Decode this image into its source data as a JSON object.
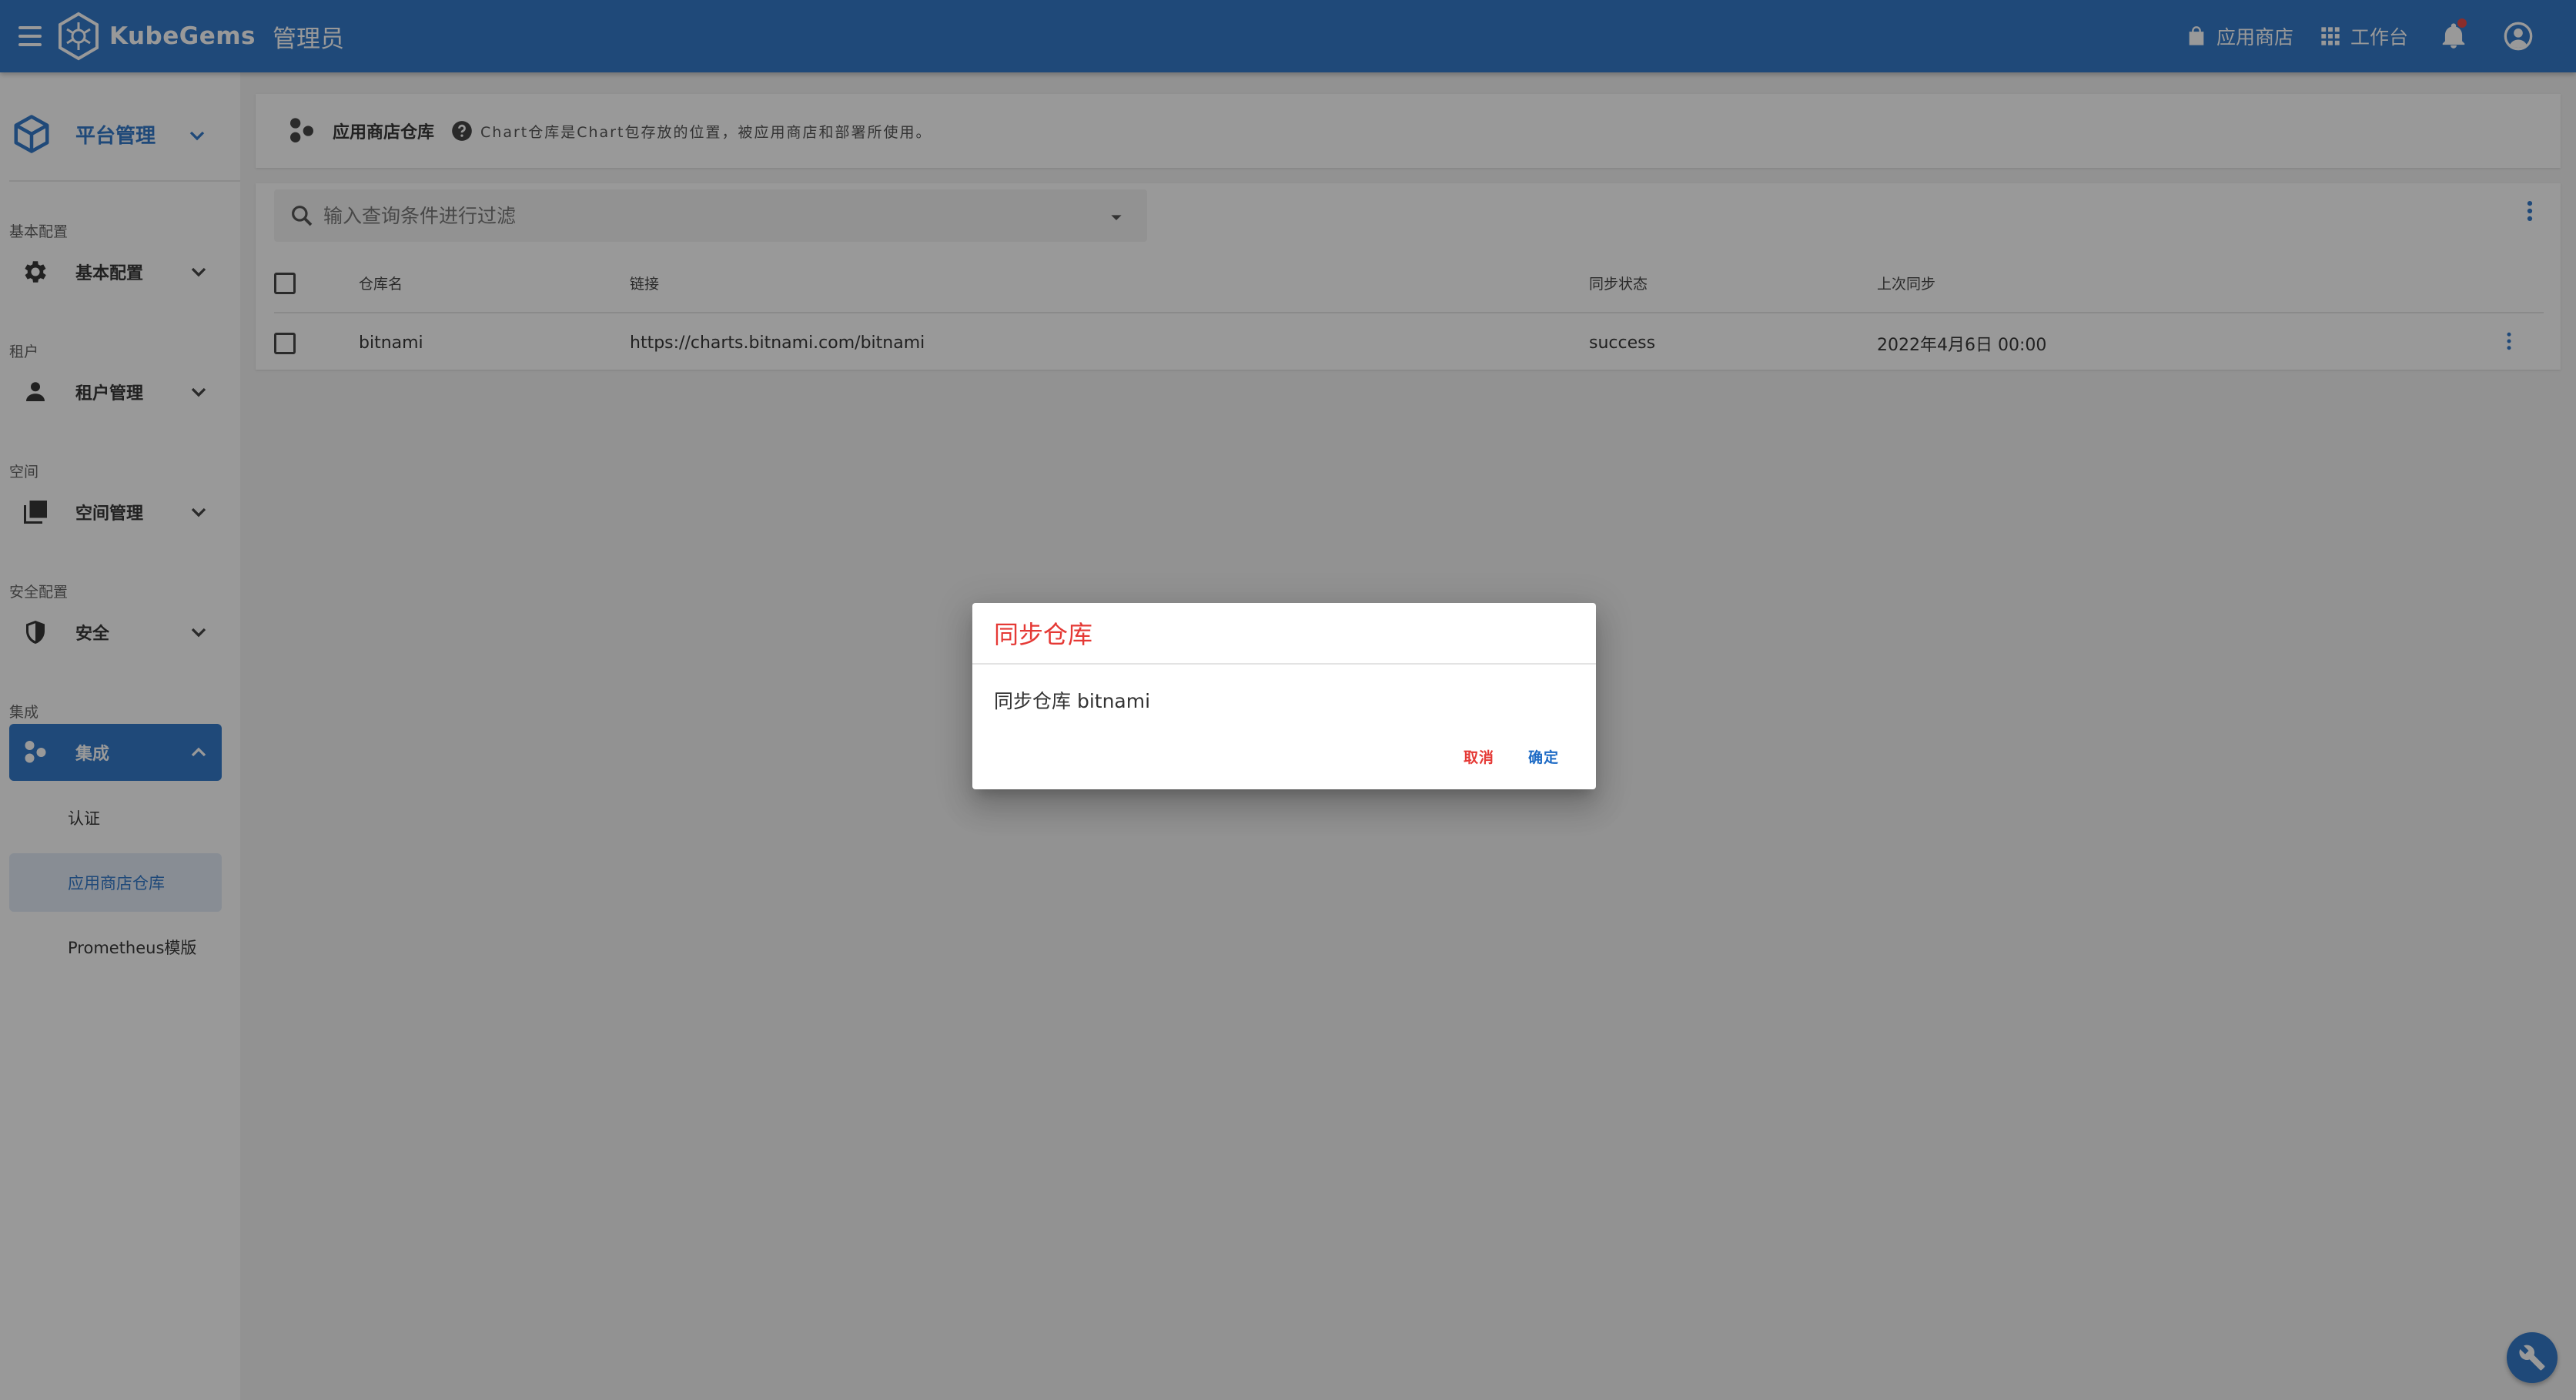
{
  "colors": {
    "primary": "#1e6bc5",
    "danger": "#e53935",
    "sidebar_active_bg": "#1e6bc5",
    "sub_active_bg": "#dfe9f6",
    "overlay": "rgba(33,33,33,0.46)"
  },
  "appbar": {
    "brand_name": "KubeGems",
    "role": "管理员",
    "links": [
      {
        "label": "应用商店",
        "icon": "shopping-bag-icon"
      },
      {
        "label": "工作台",
        "icon": "apps-grid-icon"
      }
    ],
    "icons": [
      "menu-icon",
      "bell-icon",
      "account-circle-icon"
    ]
  },
  "sidebar": {
    "tenant_label": "平台管理",
    "groups": [
      {
        "title": "基本配置",
        "item": "基本配置",
        "icon": "gear-icon"
      },
      {
        "title": "租户",
        "item": "租户管理",
        "icon": "person-icon"
      },
      {
        "title": "空间",
        "item": "空间管理",
        "icon": "library-icon"
      },
      {
        "title": "安全配置",
        "item": "安全",
        "icon": "shield-icon"
      },
      {
        "title": "集成",
        "item": "集成",
        "icon": "integration-icon",
        "expanded": true
      }
    ],
    "sub_items": [
      {
        "label": "认证",
        "active": false
      },
      {
        "label": "应用商店仓库",
        "active": true
      },
      {
        "label": "Prometheus模版",
        "active": false
      }
    ]
  },
  "page": {
    "title": "应用商店仓库",
    "description": "Chart仓库是Chart包存放的位置，被应用商店和部署所使用。"
  },
  "search": {
    "placeholder": "输入查询条件进行过滤"
  },
  "table": {
    "headers": [
      "仓库名",
      "链接",
      "同步状态",
      "上次同步"
    ],
    "rows": [
      {
        "name": "bitnami",
        "link": "https://charts.bitnami.com/bitnami",
        "status": "success",
        "last_sync": "2022年4月6日 00:00"
      }
    ]
  },
  "dialog": {
    "title": "同步仓库",
    "text": "同步仓库 bitnami",
    "cancel_label": "取消",
    "confirm_label": "确定"
  }
}
